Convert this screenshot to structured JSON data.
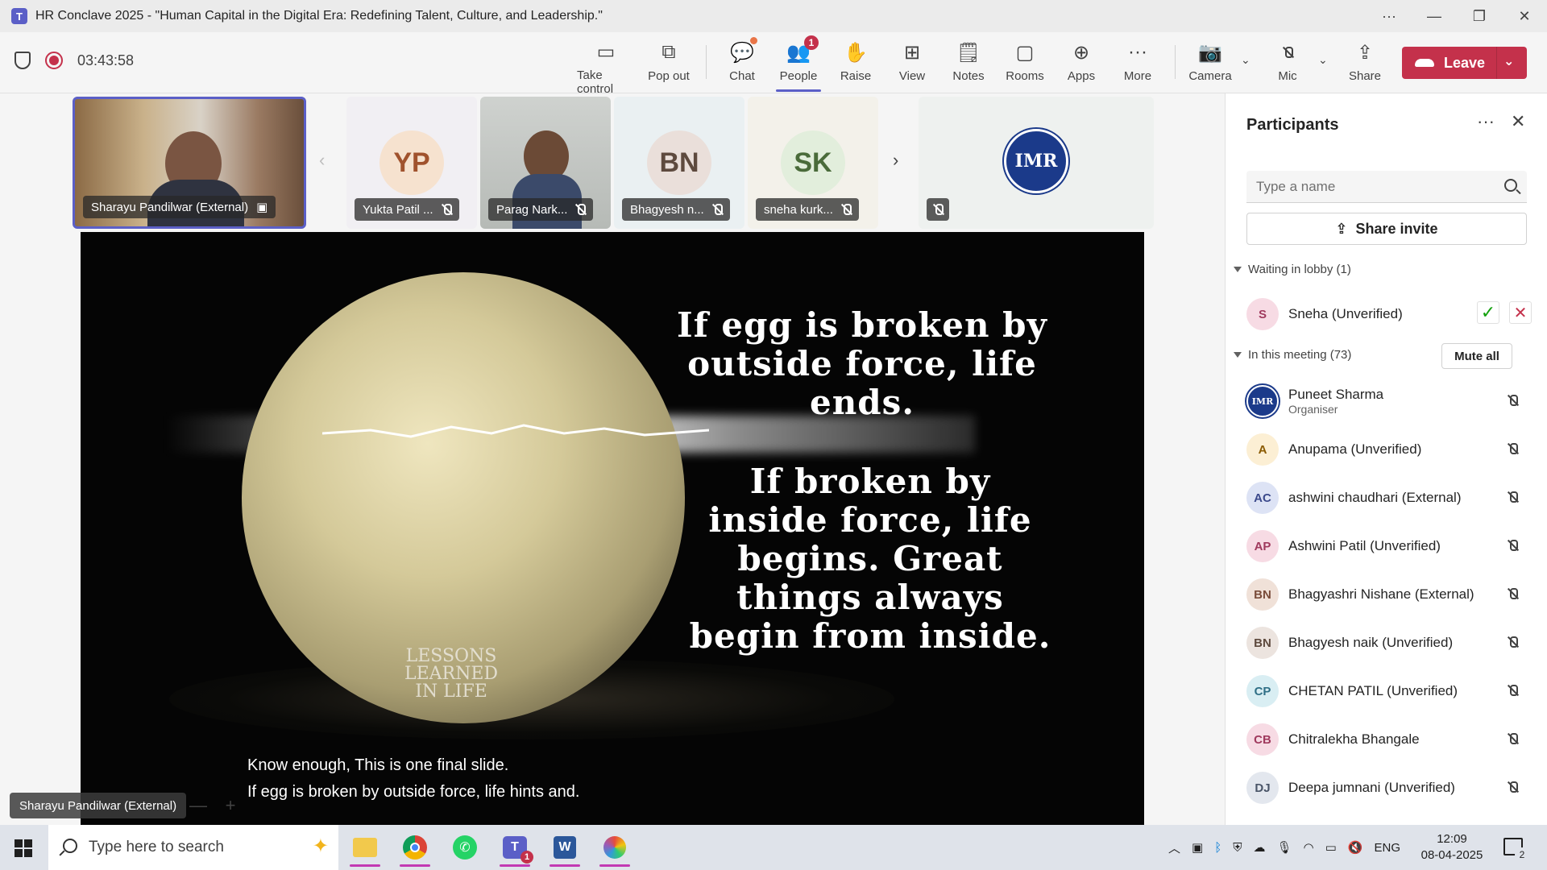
{
  "window": {
    "title": "HR Conclave 2025 - \"Human Capital in the Digital Era: Redefining Talent, Culture, and Leadership.\"",
    "app_icon": "teams-icon"
  },
  "toolbar": {
    "timer": "03:43:58",
    "buttons": [
      {
        "label": "Take control",
        "icon": "take-control-icon"
      },
      {
        "label": "Pop out",
        "icon": "pop-out-icon"
      },
      {
        "label": "Chat",
        "icon": "chat-icon"
      },
      {
        "label": "People",
        "icon": "people-icon",
        "badge": "1"
      },
      {
        "label": "Raise",
        "icon": "hand-icon"
      },
      {
        "label": "View",
        "icon": "view-icon"
      },
      {
        "label": "Notes",
        "icon": "notes-icon"
      },
      {
        "label": "Rooms",
        "icon": "rooms-icon"
      },
      {
        "label": "Apps",
        "icon": "apps-icon"
      },
      {
        "label": "More",
        "icon": "more-icon"
      },
      {
        "label": "Camera",
        "icon": "camera-off-icon"
      },
      {
        "label": "Mic",
        "icon": "mic-off-icon"
      },
      {
        "label": "Share",
        "icon": "share-icon"
      }
    ],
    "leave_label": "Leave",
    "accent": "#c4314b"
  },
  "gallery": {
    "active_speaker": "Sharayu Pandilwar (External)",
    "tiles": [
      {
        "initials": "YP",
        "name": "Yukta Patil ..."
      },
      {
        "name": "Parag Nark..."
      },
      {
        "initials": "BN",
        "name": "Bhagyesh n..."
      },
      {
        "initials": "SK",
        "name": "sneha kurk..."
      }
    ],
    "org_logo_text": "IMR"
  },
  "slide": {
    "quote_1": [
      "If egg is broken by",
      "outside force, life",
      "ends."
    ],
    "quote_2": [
      "If broken by",
      "inside force, life",
      "begins. Great",
      "things always",
      "begin from inside."
    ],
    "watermark": [
      "LESSONS",
      "LEARNED",
      "IN LIFE"
    ]
  },
  "captions": {
    "line_1": "Know enough, This is one final slide.",
    "line_2": "If egg is broken by outside force, life hints and."
  },
  "stage": {
    "speaker_label": "Sharayu Pandilwar (External)",
    "zoom_out": "—",
    "zoom_in": "+"
  },
  "participants": {
    "title": "Participants",
    "search_placeholder": "Type a name",
    "share_invite_label": "Share invite",
    "lobby_label": "Waiting in lobby (1)",
    "lobby": [
      {
        "initials": "S",
        "name": "Sneha (Unverified)"
      }
    ],
    "meeting_label": "In this meeting (73)",
    "mute_all_label": "Mute all",
    "members": [
      {
        "initials": "IMR",
        "name": "Puneet Sharma",
        "role": "Organiser",
        "color": "#1b3a8a",
        "bg": "#ffffff"
      },
      {
        "initials": "A",
        "name": "Anupama (Unverified)",
        "color": "#8a5a00",
        "bg": "#fcefd4"
      },
      {
        "initials": "AC",
        "name": "ashwini chaudhari (External)",
        "color": "#3c4a8c",
        "bg": "#dde3f5"
      },
      {
        "initials": "AP",
        "name": "Ashwini Patil (Unverified)",
        "color": "#a03a5e",
        "bg": "#f7dbe4"
      },
      {
        "initials": "BN",
        "name": "Bhagyashri Nishane (External)",
        "color": "#7a4c3a",
        "bg": "#f0e1d8"
      },
      {
        "initials": "BN",
        "name": "Bhagyesh naik (Unverified)",
        "color": "#5e4a3e",
        "bg": "#ece4df"
      },
      {
        "initials": "CP",
        "name": "CHETAN PATIL (Unverified)",
        "color": "#2f6f86",
        "bg": "#d9eef3"
      },
      {
        "initials": "CB",
        "name": "Chitralekha Bhangale",
        "color": "#a03a5e",
        "bg": "#f7dbe4"
      },
      {
        "initials": "DJ",
        "name": "Deepa jumnani (Unverified)",
        "color": "#4a5568",
        "bg": "#e3e7ee"
      }
    ]
  },
  "taskbar": {
    "search_placeholder": "Type here to search",
    "apps": [
      "file-explorer-icon",
      "chrome-icon",
      "whatsapp-icon",
      "teams-icon",
      "word-icon",
      "paint-icon"
    ],
    "teams_badge": "1",
    "language": "ENG",
    "time": "12:09",
    "date": "08-04-2025",
    "notifications": "2"
  }
}
